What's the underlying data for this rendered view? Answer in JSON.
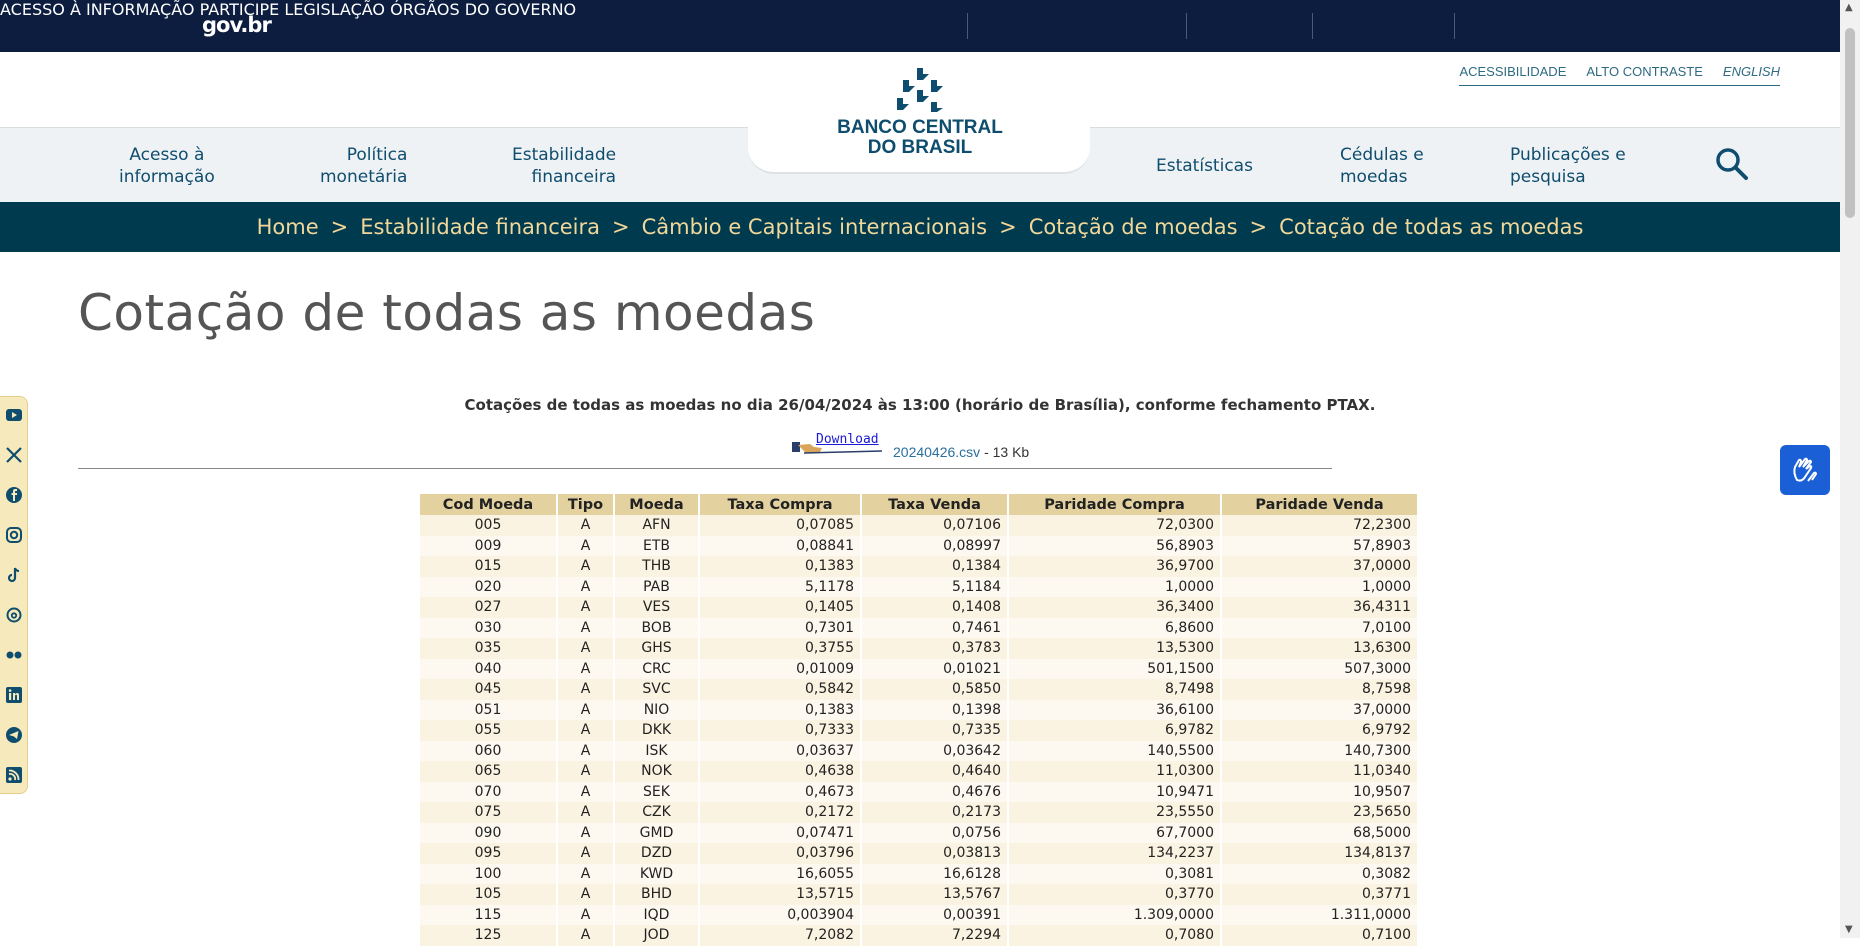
{
  "govbar": {
    "brand": "gov.br",
    "links": [
      "ACESSO À INFORMAÇÃO",
      "PARTICIPE",
      "LEGISLAÇÃO",
      "ÓRGÃOS DO GOVERNO"
    ]
  },
  "accessibility": {
    "acessibilidade": "ACESSIBILIDADE",
    "alto_contraste": "ALTO CONTRASTE",
    "english": "ENGLISH"
  },
  "logo": {
    "line1": "BANCO CENTRAL",
    "line2": "DO BRASIL"
  },
  "nav": {
    "acesso": [
      "Acesso à",
      "informação"
    ],
    "politica": [
      "Política",
      "monetária"
    ],
    "estabilidade": [
      "Estabilidade",
      "financeira"
    ],
    "estatisticas": "Estatísticas",
    "cedulas": [
      "Cédulas e",
      "moedas"
    ],
    "publicacoes": [
      "Publicações e",
      "pesquisa"
    ]
  },
  "breadcrumb": [
    "Home",
    "Estabilidade financeira",
    "Câmbio e Capitais internacionais",
    "Cotação de moedas",
    "Cotação de todas as moedas"
  ],
  "breadcrumb_sep": ">",
  "page_title": "Cotação de todas as moedas",
  "subtitle": "Cotações de todas as moedas no dia 26/04/2024 às 13:00 (horário de Brasília), conforme fechamento PTAX.",
  "download": {
    "button_label": "Download",
    "file_name": "20240426.csv",
    "file_size": " - 13 Kb"
  },
  "social_icons": [
    "youtube-icon",
    "x-icon",
    "facebook-icon",
    "instagram-icon",
    "tiktok-icon",
    "threads-icon",
    "flickr-icon",
    "linkedin-icon",
    "telegram-icon",
    "rss-icon"
  ],
  "colors": {
    "govbar": "#0c1d3f",
    "nav_text": "#0f4d6e",
    "breadcrumb_bg": "#003a4e",
    "breadcrumb_text": "#f1d79a",
    "table_header": "#e3d2a0"
  },
  "table": {
    "headers": [
      "Cod Moeda",
      "Tipo",
      "Moeda",
      "Taxa Compra",
      "Taxa Venda",
      "Paridade Compra",
      "Paridade Venda"
    ],
    "rows": [
      [
        "005",
        "A",
        "AFN",
        "0,07085",
        "0,07106",
        "72,0300",
        "72,2300"
      ],
      [
        "009",
        "A",
        "ETB",
        "0,08841",
        "0,08997",
        "56,8903",
        "57,8903"
      ],
      [
        "015",
        "A",
        "THB",
        "0,1383",
        "0,1384",
        "36,9700",
        "37,0000"
      ],
      [
        "020",
        "A",
        "PAB",
        "5,1178",
        "5,1184",
        "1,0000",
        "1,0000"
      ],
      [
        "027",
        "A",
        "VES",
        "0,1405",
        "0,1408",
        "36,3400",
        "36,4311"
      ],
      [
        "030",
        "A",
        "BOB",
        "0,7301",
        "0,7461",
        "6,8600",
        "7,0100"
      ],
      [
        "035",
        "A",
        "GHS",
        "0,3755",
        "0,3783",
        "13,5300",
        "13,6300"
      ],
      [
        "040",
        "A",
        "CRC",
        "0,01009",
        "0,01021",
        "501,1500",
        "507,3000"
      ],
      [
        "045",
        "A",
        "SVC",
        "0,5842",
        "0,5850",
        "8,7498",
        "8,7598"
      ],
      [
        "051",
        "A",
        "NIO",
        "0,1383",
        "0,1398",
        "36,6100",
        "37,0000"
      ],
      [
        "055",
        "A",
        "DKK",
        "0,7333",
        "0,7335",
        "6,9782",
        "6,9792"
      ],
      [
        "060",
        "A",
        "ISK",
        "0,03637",
        "0,03642",
        "140,5500",
        "140,7300"
      ],
      [
        "065",
        "A",
        "NOK",
        "0,4638",
        "0,4640",
        "11,0300",
        "11,0340"
      ],
      [
        "070",
        "A",
        "SEK",
        "0,4673",
        "0,4676",
        "10,9471",
        "10,9507"
      ],
      [
        "075",
        "A",
        "CZK",
        "0,2172",
        "0,2173",
        "23,5550",
        "23,5650"
      ],
      [
        "090",
        "A",
        "GMD",
        "0,07471",
        "0,0756",
        "67,7000",
        "68,5000"
      ],
      [
        "095",
        "A",
        "DZD",
        "0,03796",
        "0,03813",
        "134,2237",
        "134,8137"
      ],
      [
        "100",
        "A",
        "KWD",
        "16,6055",
        "16,6128",
        "0,3081",
        "0,3082"
      ],
      [
        "105",
        "A",
        "BHD",
        "13,5715",
        "13,5767",
        "0,3770",
        "0,3771"
      ],
      [
        "115",
        "A",
        "IQD",
        "0,003904",
        "0,00391",
        "1.309,0000",
        "1.311,0000"
      ],
      [
        "125",
        "A",
        "JOD",
        "7,2082",
        "7,2294",
        "0,7080",
        "0,7100"
      ]
    ]
  }
}
